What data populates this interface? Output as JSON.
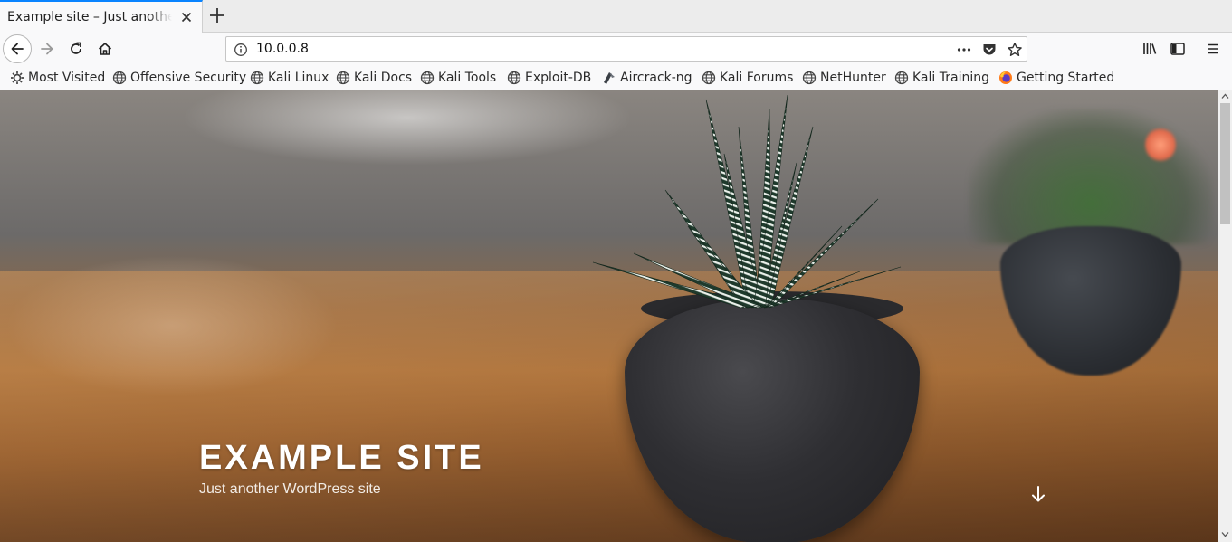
{
  "browser": {
    "tab": {
      "title": "Example site – Just another WordPress site"
    },
    "address_bar": {
      "url": "10.0.0.8"
    },
    "icons": {
      "back": "back-arrow-icon",
      "forward": "forward-arrow-icon",
      "reload": "reload-icon",
      "home": "home-icon",
      "page_info": "info-icon",
      "page_actions": "ellipsis-icon",
      "pocket": "pocket-icon",
      "bookmark_star": "star-icon",
      "library": "library-icon",
      "sidebar": "sidebar-icon",
      "menu": "hamburger-menu-icon",
      "new_tab": "plus-icon",
      "close_tab": "close-icon"
    },
    "bookmarks": [
      {
        "label": "Most Visited",
        "icon": "gear-icon"
      },
      {
        "label": "Offensive Security",
        "icon": "globe-icon"
      },
      {
        "label": "Kali Linux",
        "icon": "globe-icon"
      },
      {
        "label": "Kali Docs",
        "icon": "globe-icon"
      },
      {
        "label": "Kali Tools",
        "icon": "globe-icon"
      },
      {
        "label": "Exploit-DB",
        "icon": "globe-icon"
      },
      {
        "label": "Aircrack-ng",
        "icon": "aircrack-icon"
      },
      {
        "label": "Kali Forums",
        "icon": "globe-icon"
      },
      {
        "label": "NetHunter",
        "icon": "globe-icon"
      },
      {
        "label": "Kali Training",
        "icon": "globe-icon"
      },
      {
        "label": "Getting Started",
        "icon": "firefox-icon"
      }
    ]
  },
  "page": {
    "site_title": "EXAMPLE SITE",
    "tagline": "Just another WordPress site",
    "hero_image": "potted-zebra-plant-on-wooden-table",
    "scroll_icon": "arrow-down-icon"
  },
  "colors": {
    "tab_accent": "#0a84ff",
    "toolbar_bg": "#f9f9fa",
    "title_text": "#ffffff"
  }
}
